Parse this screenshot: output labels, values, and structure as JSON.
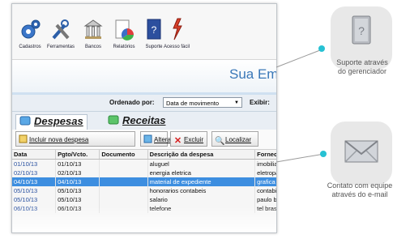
{
  "toolbar": {
    "items": [
      {
        "label": "Cadastros",
        "icon": "gears-icon"
      },
      {
        "label": "Ferramentas",
        "icon": "tools-icon"
      },
      {
        "label": "Bancos",
        "icon": "bank-icon"
      },
      {
        "label": "Relatórios",
        "icon": "report-chart-icon"
      },
      {
        "label": "Suporte",
        "icon": "support-book-icon"
      },
      {
        "label": "Acesso fácil",
        "icon": "quick-access-icon"
      }
    ]
  },
  "banner": {
    "title": "Sua Em"
  },
  "order": {
    "label": "Ordenado por:",
    "value": "Data de movimento",
    "exibir": "Exibir:"
  },
  "tabs": [
    {
      "label": "Despesas"
    },
    {
      "label": "Receitas"
    }
  ],
  "actions": {
    "add": "Incluir nova despesa",
    "edit": "Alterar",
    "delete": "Excluir",
    "find": "Localizar"
  },
  "grid": {
    "headers": [
      "Data",
      "Pgto/Vcto.",
      "Documento",
      "Descrição da despesa",
      "Fornecedor"
    ],
    "rows": [
      [
        "01/10/13",
        "01/10/13",
        "",
        "aluguel",
        "imobiliaria brasil"
      ],
      [
        "02/10/13",
        "02/10/13",
        "",
        "energia eletrica",
        "eletropaulo"
      ],
      [
        "04/10/13",
        "04/10/13",
        "",
        "material de expediente",
        "grafica brasil"
      ],
      [
        "05/10/13",
        "05/10/13",
        "",
        "honorarios contabeis",
        "contabil brasil"
      ],
      [
        "05/10/13",
        "05/10/13",
        "",
        "salario",
        "paulo brasil"
      ],
      [
        "06/10/13",
        "06/10/13",
        "",
        "telefone",
        "tel brasil"
      ]
    ],
    "selected_row": 2
  },
  "callouts": [
    {
      "text_line1": "Suporte através",
      "text_line2": "do gerenciador",
      "icon": "support-book-icon"
    },
    {
      "text_line1": "Contato com equipe",
      "text_line2": "através do e-mail",
      "icon": "envelope-icon"
    }
  ],
  "colors": {
    "accent": "#27c1d3",
    "selection": "#3d8ee0",
    "banner_text": "#3a78b8"
  }
}
